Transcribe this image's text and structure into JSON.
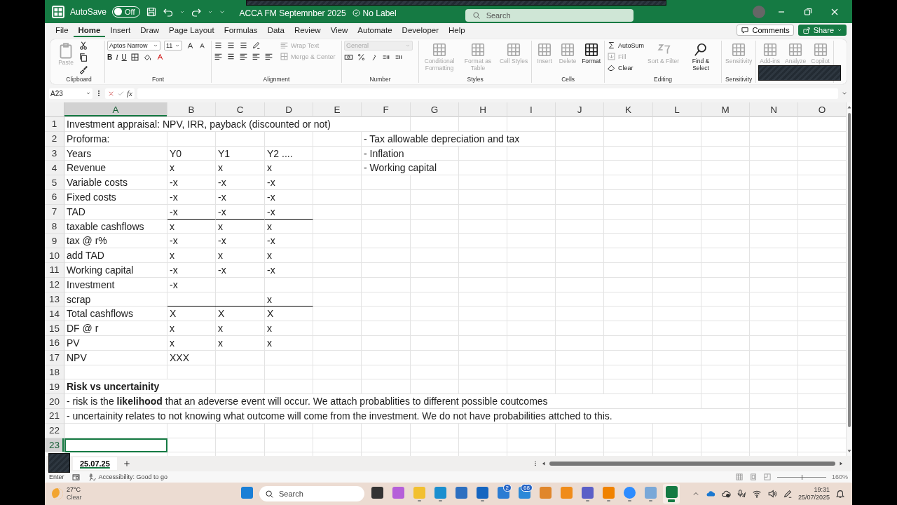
{
  "title_bar": {
    "autosave": {
      "label": "AutoSave",
      "toggle": "Off",
      "on": false
    },
    "title": "ACCA FM Septemnber 2025",
    "label": "No Label",
    "search": {
      "placeholder": "Search"
    }
  },
  "menu": {
    "tabs": [
      {
        "label": "File",
        "selected": false
      },
      {
        "label": "Home",
        "selected": true
      },
      {
        "label": "Insert",
        "selected": false
      },
      {
        "label": "Draw",
        "selected": false
      },
      {
        "label": "Page Layout",
        "selected": false
      },
      {
        "label": "Formulas",
        "selected": false
      },
      {
        "label": "Data",
        "selected": false
      },
      {
        "label": "Review",
        "selected": false
      },
      {
        "label": "View",
        "selected": false
      },
      {
        "label": "Automate",
        "selected": false
      },
      {
        "label": "Developer",
        "selected": false
      },
      {
        "label": "Help",
        "selected": false
      }
    ],
    "comments": "Comments",
    "share": "Share"
  },
  "ribbon": {
    "groups": [
      {
        "kind": "clipboard",
        "label": "Clipboard",
        "buttons": [
          {
            "label": "Paste",
            "disabled": true
          }
        ]
      },
      {
        "kind": "font",
        "label": "Font",
        "font": "Aptos Narrow",
        "size": "11",
        "format_buttons": [
          "B",
          "I",
          "U"
        ]
      },
      {
        "kind": "alignment",
        "label": "Alignment",
        "buttons": [
          {
            "label": "Wrap Text",
            "disabled": true
          },
          {
            "label": "Merge & Center",
            "disabled": true
          }
        ]
      },
      {
        "kind": "number",
        "label": "Number",
        "format": {
          "value": "General",
          "disabled": true
        }
      },
      {
        "kind": "large",
        "label": "Styles",
        "buttons": [
          {
            "label": "Conditional Formatting",
            "disabled": true
          },
          {
            "label": "Format as Table",
            "disabled": true
          },
          {
            "label": "Cell Styles",
            "disabled": true
          }
        ]
      },
      {
        "kind": "large",
        "label": "Cells",
        "buttons": [
          {
            "label": "Insert",
            "disabled": true
          },
          {
            "label": "Delete",
            "disabled": true
          },
          {
            "label": "Format",
            "disabled": false
          }
        ]
      },
      {
        "kind": "editing",
        "label": "Editing",
        "small": [
          {
            "label": "AutoSum",
            "disabled": false
          },
          {
            "label": "Fill",
            "disabled": true
          },
          {
            "label": "Clear",
            "disabled": false
          }
        ],
        "buttons": [
          {
            "label": "Sort & Filter",
            "disabled": true
          },
          {
            "label": "Find & Select",
            "disabled": false
          }
        ]
      },
      {
        "kind": "large",
        "label": "Sensitivity",
        "buttons": [
          {
            "label": "Sensitivity",
            "disabled": true
          }
        ]
      },
      {
        "kind": "large",
        "buttons": [
          {
            "label": "Add-ins",
            "disabled": true
          },
          {
            "label": "Analyze",
            "disabled": true
          },
          {
            "label": "Copilot",
            "disabled": true
          }
        ]
      }
    ]
  },
  "formula_bar": {
    "name_box": "A23",
    "function_label": "fx"
  },
  "columns": [
    {
      "label": "A",
      "selected": true
    },
    {
      "label": "B",
      "selected": false
    },
    {
      "label": "C",
      "selected": false
    },
    {
      "label": "D",
      "selected": false
    },
    {
      "label": "E",
      "selected": false
    },
    {
      "label": "F",
      "selected": false
    },
    {
      "label": "G",
      "selected": false
    },
    {
      "label": "H",
      "selected": false
    },
    {
      "label": "I",
      "selected": false
    },
    {
      "label": "J",
      "selected": false
    },
    {
      "label": "K",
      "selected": false
    },
    {
      "label": "L",
      "selected": false
    },
    {
      "label": "M",
      "selected": false
    },
    {
      "label": "N",
      "selected": false
    },
    {
      "label": "O",
      "selected": false
    }
  ],
  "rows": [
    {
      "number": "1",
      "selected": false,
      "cells": [
        "Investment appraisal: NPV, IRR, payback (discounted or not)"
      ]
    },
    {
      "number": "2",
      "selected": false,
      "cells": [
        "Proforma:",
        null,
        null,
        null,
        null,
        "- Tax allowable depreciation and tax"
      ]
    },
    {
      "number": "3",
      "selected": false,
      "cells": [
        "Years",
        "Y0",
        "Y1",
        "Y2 ....",
        null,
        "- Inflation"
      ]
    },
    {
      "number": "4",
      "selected": false,
      "cells": [
        "Revenue",
        "x",
        "x",
        "x",
        null,
        "- Working capital"
      ]
    },
    {
      "number": "5",
      "selected": false,
      "cells": [
        "Variable costs",
        "-x",
        "-x",
        "-x"
      ]
    },
    {
      "number": "6",
      "selected": false,
      "cells": [
        "Fixed costs",
        "-x",
        "-x",
        "-x"
      ]
    },
    {
      "number": "7",
      "selected": false,
      "rule_below": true,
      "cells": [
        "TAD",
        "-x",
        "-x",
        "-x"
      ]
    },
    {
      "number": "8",
      "selected": false,
      "cells": [
        "taxable cashflows",
        "x",
        "x",
        "x"
      ]
    },
    {
      "number": "9",
      "selected": false,
      "cells": [
        "tax @ r%",
        "-x",
        "-x",
        "-x"
      ]
    },
    {
      "number": "10",
      "selected": false,
      "cells": [
        "add TAD",
        "x",
        "x",
        "x"
      ]
    },
    {
      "number": "11",
      "selected": false,
      "cells": [
        "Working capital",
        "-x",
        "-x",
        "-x"
      ]
    },
    {
      "number": "12",
      "selected": false,
      "cells": [
        "Investment",
        "-x"
      ]
    },
    {
      "number": "13",
      "selected": false,
      "rule_below": true,
      "cells": [
        "scrap",
        null,
        null,
        "x"
      ]
    },
    {
      "number": "14",
      "selected": false,
      "cells": [
        "Total cashflows",
        "X",
        "X",
        "X"
      ]
    },
    {
      "number": "15",
      "selected": false,
      "cells": [
        "DF @ r",
        "x",
        "x",
        "x"
      ]
    },
    {
      "number": "16",
      "selected": false,
      "cells": [
        "PV",
        "x",
        "x",
        "x"
      ]
    },
    {
      "number": "17",
      "selected": false,
      "cells": [
        "NPV",
        "XXX"
      ]
    },
    {
      "number": "18",
      "selected": false
    },
    {
      "number": "19",
      "selected": false,
      "bold": true,
      "cells": [
        "Risk vs uncertainity"
      ]
    },
    {
      "number": "20",
      "selected": false,
      "cells": [
        "- risk is the **likelihood** that an adeverse event will occur. We attach probablities to different possible coutcomes"
      ]
    },
    {
      "number": "21",
      "selected": false,
      "cells": [
        "- uncertainity relates to not knowing what outcome will come from the investment. We do not have probabilities attched to this."
      ]
    },
    {
      "number": "22",
      "selected": false
    },
    {
      "number": "23",
      "selected": true
    }
  ],
  "sheet_tabs": [
    {
      "label": "25.07.25",
      "selected": true
    }
  ],
  "status_bar": {
    "mode": "Enter",
    "accessibility": "Accessibility: Good to go",
    "zoom": {
      "level": 0.5,
      "reading": "160%"
    }
  },
  "taskbar": {
    "weather": {
      "temperature": "27°C",
      "condition": "Clear"
    },
    "search": {
      "placeholder": "Search"
    },
    "apps": [
      {
        "kind": "windows",
        "running": false,
        "active": false
      },
      {
        "kind": "desktops",
        "running": false,
        "active": false
      },
      {
        "kind": "copilot",
        "running": false,
        "active": false
      },
      {
        "kind": "folder",
        "running": true,
        "active": false
      },
      {
        "kind": "browser",
        "running": true,
        "active": false
      },
      {
        "kind": "store",
        "running": false,
        "active": false
      },
      {
        "kind": "mail",
        "running": true,
        "active": false
      },
      {
        "kind": "tasks",
        "badge": "2",
        "running": false,
        "active": false
      },
      {
        "kind": "remote",
        "badge": "68",
        "running": false,
        "active": false
      },
      {
        "kind": "book",
        "running": false,
        "active": false
      },
      {
        "kind": "magnifier",
        "running": false,
        "active": false
      },
      {
        "kind": "chat",
        "running": true,
        "active": false
      },
      {
        "kind": "cone",
        "running": true,
        "active": false
      },
      {
        "kind": "video",
        "running": true,
        "active": false
      },
      {
        "kind": "document",
        "running": true,
        "active": false
      },
      {
        "kind": "spreadsheet",
        "running": true,
        "active": true
      }
    ],
    "time": "19:31",
    "date": "25/07/2025"
  }
}
